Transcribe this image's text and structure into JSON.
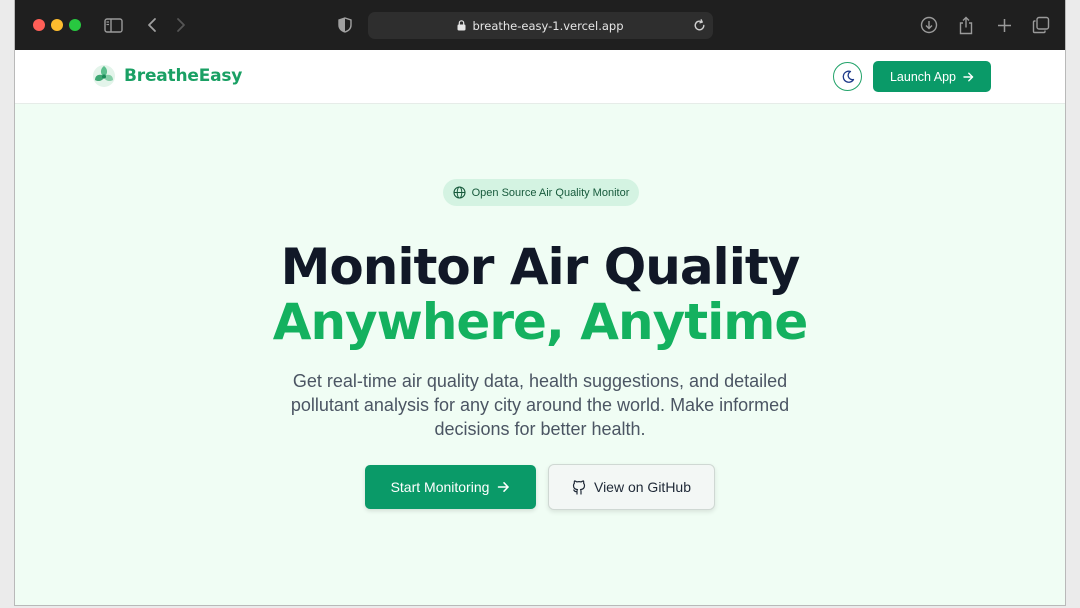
{
  "browser": {
    "url": "breathe-easy-1.vercel.app"
  },
  "header": {
    "brand_name": "BreatheEasy",
    "launch_label": "Launch App"
  },
  "hero": {
    "badge": "Open Source Air Quality Monitor",
    "title_line1": "Monitor Air Quality",
    "title_line2": "Anywhere, Anytime",
    "description": "Get real-time air quality data, health suggestions, and detailed pollutant analysis for any city around the world. Make informed decisions for better health.",
    "primary_cta": "Start Monitoring",
    "secondary_cta": "View on GitHub"
  },
  "colors": {
    "brand_green": "#0a9a68",
    "headline_green": "#14b15f",
    "hero_background": "#f0fdf4"
  },
  "icons": [
    "sidebar-icon",
    "back-icon",
    "forward-icon",
    "shield-icon",
    "lock-icon",
    "reload-icon",
    "download-icon",
    "share-icon",
    "new-tab-icon",
    "tabs-overview-icon",
    "logo-icon",
    "moon-icon",
    "arrow-right-icon",
    "globe-icon",
    "github-icon"
  ]
}
